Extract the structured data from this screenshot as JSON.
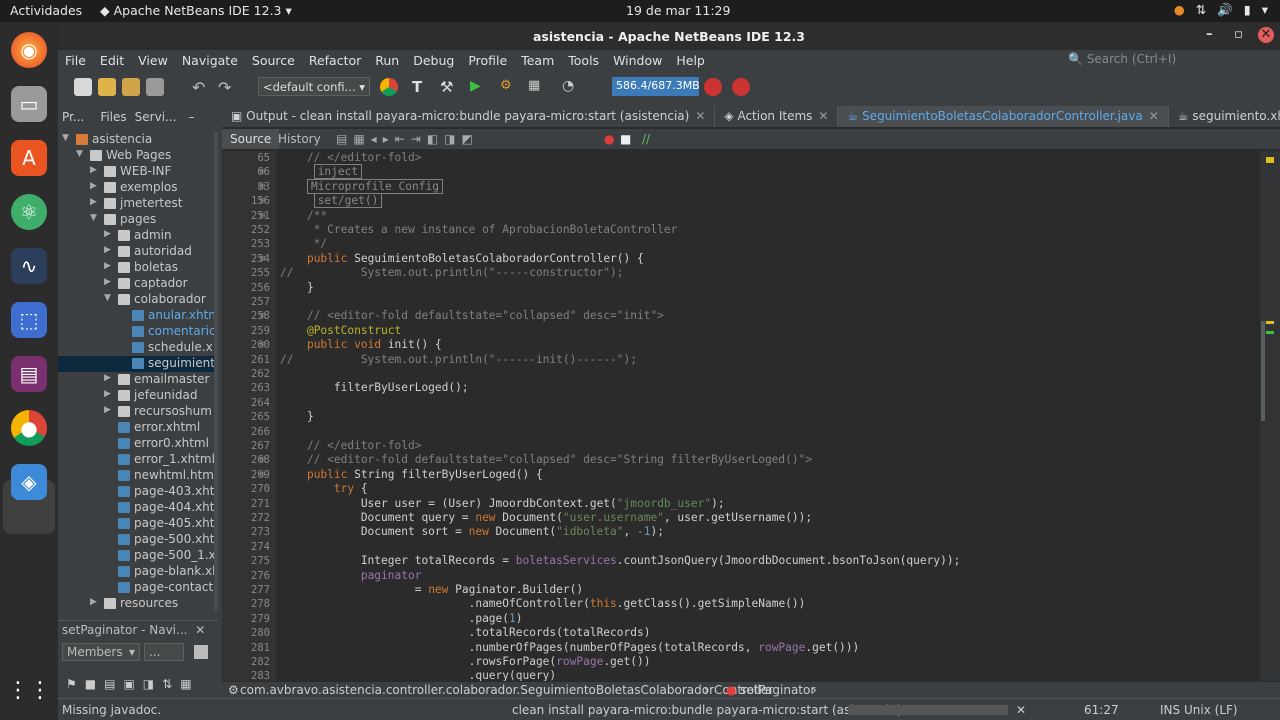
{
  "topbar": {
    "activities": "Actividades",
    "app_name": "Apache NetBeans IDE 12.3",
    "clock": "19 de mar  11:29"
  },
  "window": {
    "title": "asistencia - Apache NetBeans IDE 12.3"
  },
  "menu": [
    "File",
    "Edit",
    "View",
    "Navigate",
    "Source",
    "Refactor",
    "Run",
    "Debug",
    "Profile",
    "Team",
    "Tools",
    "Window",
    "Help"
  ],
  "search": {
    "placeholder": "Search (Ctrl+I)"
  },
  "toolbar": {
    "config": "<default confi...",
    "memory": "586.4/687.3MB"
  },
  "left_tabs": [
    "Pr...",
    "Files",
    "Servi..."
  ],
  "tree": [
    {
      "label": "asistencia",
      "depth": 0,
      "type": "project",
      "open": true
    },
    {
      "label": "Web Pages",
      "depth": 1,
      "type": "folder",
      "open": true
    },
    {
      "label": "WEB-INF",
      "depth": 2,
      "type": "folder"
    },
    {
      "label": "exemplos",
      "depth": 2,
      "type": "folder"
    },
    {
      "label": "jmetertest",
      "depth": 2,
      "type": "folder"
    },
    {
      "label": "pages",
      "depth": 2,
      "type": "folder",
      "open": true
    },
    {
      "label": "admin",
      "depth": 3,
      "type": "folder"
    },
    {
      "label": "autoridad",
      "depth": 3,
      "type": "folder"
    },
    {
      "label": "boletas",
      "depth": 3,
      "type": "folder"
    },
    {
      "label": "captador",
      "depth": 3,
      "type": "folder"
    },
    {
      "label": "colaborador",
      "depth": 3,
      "type": "folder",
      "open": true
    },
    {
      "label": "anular.xhtn",
      "depth": 4,
      "type": "file",
      "link": true
    },
    {
      "label": "comentaric",
      "depth": 4,
      "type": "file",
      "link": true
    },
    {
      "label": "schedule.x",
      "depth": 4,
      "type": "file"
    },
    {
      "label": "seguimient",
      "depth": 4,
      "type": "file",
      "selected": true
    },
    {
      "label": "emailmaster",
      "depth": 3,
      "type": "folder"
    },
    {
      "label": "jefeunidad",
      "depth": 3,
      "type": "folder"
    },
    {
      "label": "recursoshum",
      "depth": 3,
      "type": "folder"
    },
    {
      "label": "error.xhtml",
      "depth": 3,
      "type": "file"
    },
    {
      "label": "error0.xhtml",
      "depth": 3,
      "type": "file"
    },
    {
      "label": "error_1.xhtml",
      "depth": 3,
      "type": "file"
    },
    {
      "label": "newhtml.html",
      "depth": 3,
      "type": "file"
    },
    {
      "label": "page-403.xht",
      "depth": 3,
      "type": "file"
    },
    {
      "label": "page-404.xht",
      "depth": 3,
      "type": "file"
    },
    {
      "label": "page-405.xht",
      "depth": 3,
      "type": "file"
    },
    {
      "label": "page-500.xht",
      "depth": 3,
      "type": "file"
    },
    {
      "label": "page-500_1.x",
      "depth": 3,
      "type": "file"
    },
    {
      "label": "page-blank.xh",
      "depth": 3,
      "type": "file"
    },
    {
      "label": "page-contact.",
      "depth": 3,
      "type": "file"
    },
    {
      "label": "resources",
      "depth": 2,
      "type": "folder"
    }
  ],
  "navigator": {
    "title": "setPaginator - Navi...",
    "members": "Members",
    "filter": "..."
  },
  "editor_tabs": [
    {
      "label": "Output - clean install payara-micro:bundle payara-micro:start (asistencia)",
      "active": false
    },
    {
      "label": "Action Items",
      "active": false
    },
    {
      "label": "SeguimientoBoletasColaboradorController.java",
      "active": true
    },
    {
      "label": "seguimiento.xhtml",
      "active": false
    }
  ],
  "source_bar": {
    "source": "Source",
    "history": "History"
  },
  "line_numbers": [
    "65",
    "66",
    "83",
    "156",
    "251",
    "252",
    "253",
    "254",
    "255",
    "256",
    "257",
    "258",
    "259",
    "260",
    "261",
    "262",
    "263",
    "264",
    "265",
    "266",
    "267",
    "268",
    "269",
    "270",
    "271",
    "272",
    "273",
    "274",
    "275",
    "276",
    "277",
    "278",
    "279",
    "280",
    "281",
    "282",
    "283"
  ],
  "code": [
    "    // </editor-fold>",
    "     inject ",
    "    Microprofile Config ",
    "     set/get() ",
    "    /**",
    "     * Creates a new instance of AprobacionBoletaController",
    "     */",
    "    public SeguimientoBoletasColaboradorController() {",
    "//          System.out.println(\"-----constructor\");",
    "    }",
    "",
    "    // <editor-fold defaultstate=\"collapsed\" desc=\"init\">",
    "    @PostConstruct",
    "    public void init() {",
    "//          System.out.println(\"------init()------\");",
    "",
    "        filterByUserLoged();",
    "",
    "    }",
    "",
    "    // </editor-fold>",
    "    // <editor-fold defaultstate=\"collapsed\" desc=\"String filterByUserLoged()\">",
    "    public String filterByUserLoged() {",
    "        try {",
    "            User user = (User) JmoordbContext.get(\"jmoordb_user\");",
    "            Document query = new Document(\"user.username\", user.getUsername());",
    "            Document sort = new Document(\"idboleta\", -1);",
    "",
    "            Integer totalRecords = boletasServices.countJsonQuery(JmoordbDocument.bsonToJson(query));",
    "            paginator",
    "                    = new Paginator.Builder()",
    "                            .nameOfController(this.getClass().getSimpleName())",
    "                            .page(1)",
    "                            .totalRecords(totalRecords)",
    "                            .numberOfPages(numberOfPages(totalRecords, rowPage.get()))",
    "                            .rowsForPage(rowPage.get())",
    "                            .query(query)"
  ],
  "breadcrumb": {
    "path": "com.avbravo.asistencia.controller.colaborador.SeguimientoBoletasColaboradorController",
    "method": "setPaginator"
  },
  "status": {
    "left": "Missing javadoc.",
    "task": "clean install payara-micro:bundle payara-micro:start (asistencia)",
    "position": "61:27",
    "mode": "INS",
    "line_ending": "Unix (LF)"
  },
  "colors": {
    "accent": "#3d7ab8",
    "selected_tab": "#5fa9e8",
    "keyword": "#cc7832",
    "string": "#6a8759",
    "comment": "#808080"
  }
}
